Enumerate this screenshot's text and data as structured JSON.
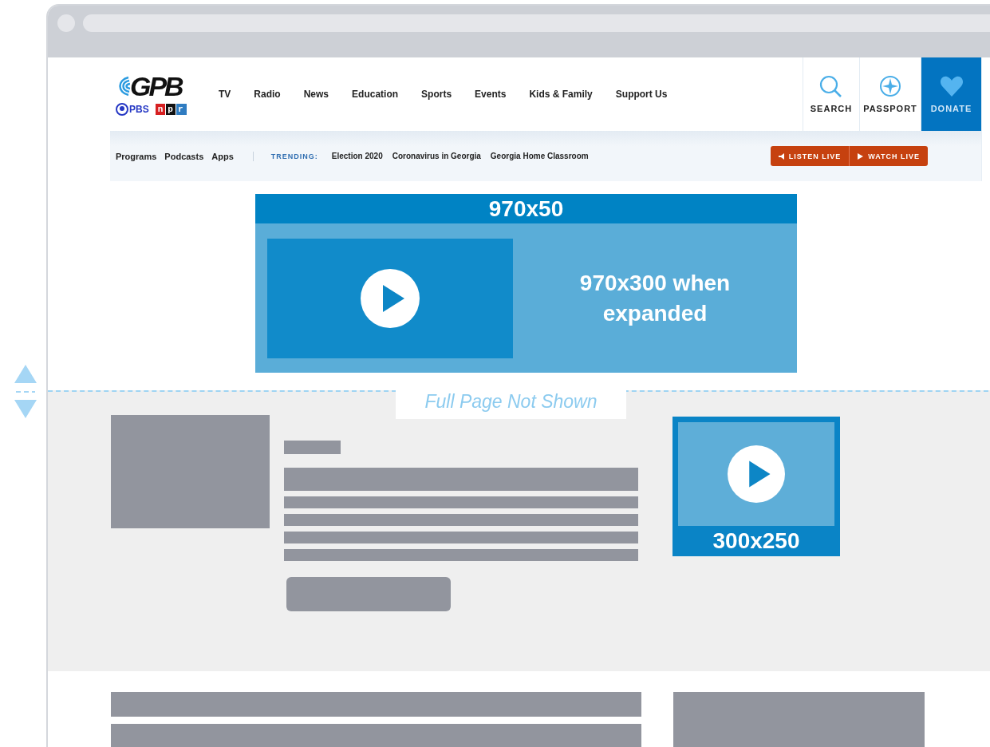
{
  "site": {
    "logo": "GPB",
    "partners": [
      {
        "name": "PBS",
        "kind": "pbs"
      },
      {
        "name": "npr",
        "kind": "npr"
      }
    ]
  },
  "nav": [
    "TV",
    "Radio",
    "News",
    "Education",
    "Sports",
    "Events",
    "Kids & Family",
    "Support Us"
  ],
  "actions": [
    {
      "label": "SEARCH",
      "kind": "search"
    },
    {
      "label": "PASSPORT",
      "kind": "passport"
    },
    {
      "label": "DONATE",
      "kind": "donate"
    }
  ],
  "subnav": [
    "Programs",
    "Podcasts",
    "Apps"
  ],
  "trending": {
    "label": "TRENDING:",
    "items": [
      "Election 2020",
      "Coronavirus in Georgia",
      "Georgia Home Classroom"
    ]
  },
  "live_buttons": [
    {
      "label": "LISTEN LIVE",
      "kind": "listen"
    },
    {
      "label": "WATCH LIVE",
      "kind": "watch"
    }
  ],
  "banner_ad": {
    "label": "970x50",
    "expanded_label": "970x300 when expanded"
  },
  "fold_note": "Full Page Not Shown",
  "box_ad": {
    "label": "300x250"
  }
}
